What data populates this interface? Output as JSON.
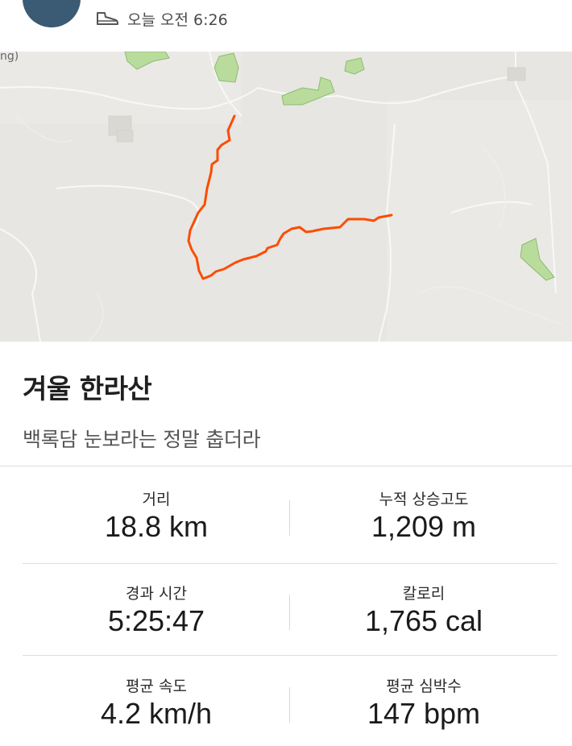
{
  "header": {
    "timestamp": "오늘 오전 6:26",
    "activity_icon": "hiking-shoe-icon"
  },
  "map": {
    "edge_label_left": "ng)",
    "route_color": "#fc4c02",
    "park_color": "#b9dc9c"
  },
  "activity": {
    "title": "겨울 한라산",
    "description": "백록담 눈보라는 정말 춥더라"
  },
  "stats": [
    {
      "left": {
        "label": "거리",
        "value": "18.8 km"
      },
      "right": {
        "label": "누적 상승고도",
        "value": "1,209 m"
      }
    },
    {
      "left": {
        "label": "경과 시간",
        "value": "5:25:47"
      },
      "right": {
        "label": "칼로리",
        "value": "1,765 cal"
      }
    },
    {
      "left": {
        "label": "평균 속도",
        "value": "4.2 km/h"
      },
      "right": {
        "label": "평균 심박수",
        "value": "147 bpm"
      }
    }
  ]
}
